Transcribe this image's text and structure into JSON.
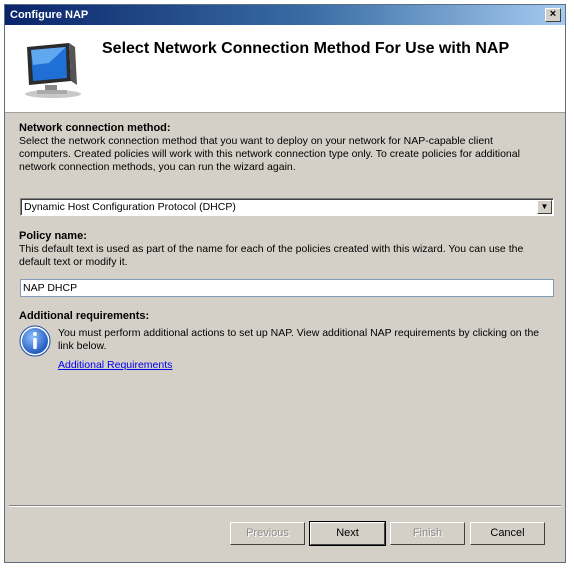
{
  "window": {
    "title": "Configure NAP",
    "close_label": "×"
  },
  "header": {
    "title": "Select Network Connection Method For Use with NAP"
  },
  "connection": {
    "label": "Network connection method:",
    "description": "Select the network connection method that you want to deploy on your network for NAP-capable client computers. Created policies will work with this network connection type only. To create policies for additional network connection methods, you can run the wizard again.",
    "selected": "Dynamic Host Configuration Protocol (DHCP)"
  },
  "policy": {
    "label": "Policy name:",
    "description": "This default text is used as part of the name for each of the policies created with this wizard. You can use the default text or modify it.",
    "value": "NAP DHCP"
  },
  "requirements": {
    "label": "Additional requirements:",
    "description": "You must perform additional actions to set up NAP. View additional NAP requirements by clicking on the link below.",
    "link": "Additional Requirements"
  },
  "buttons": {
    "previous": "Previous",
    "next": "Next",
    "finish": "Finish",
    "cancel": "Cancel"
  },
  "icons": {
    "header": "computer-monitor-icon",
    "info": "information-icon",
    "dropdown": "chevron-down-icon"
  },
  "colors": {
    "titlebar": "#0a246a",
    "dialog_bg": "#d4d0c8",
    "link": "#0000ee"
  }
}
